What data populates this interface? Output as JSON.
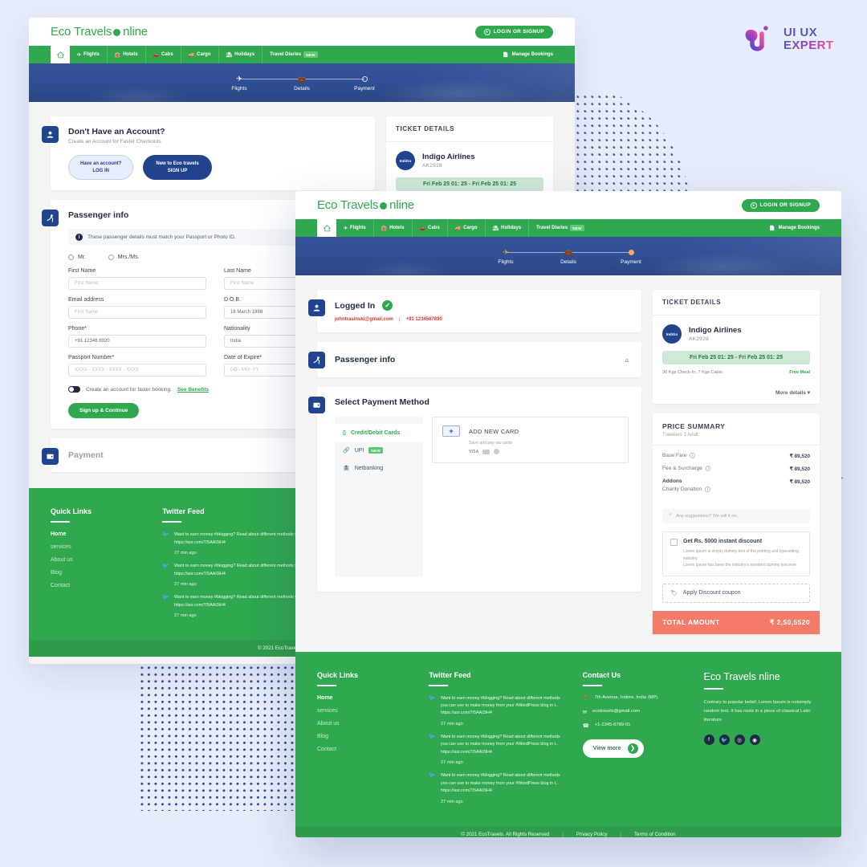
{
  "brand_logo": {
    "line1": "UI UX",
    "line2": "EXPERT"
  },
  "colors": {
    "green": "#2fa84f",
    "navy": "#22448f",
    "hero": "#2b4a93",
    "accent_orange": "#f09b2e",
    "total_bar": "#f47b6a",
    "red_text": "#e0342c"
  },
  "header": {
    "logo_prefix": "Eco Travels ",
    "logo_suffix": "nline",
    "login_button": "LOGIN OR SIGNUP",
    "login_icon": "user-icon"
  },
  "nav": {
    "home_icon": "home-icon",
    "items": [
      {
        "label": "Flights",
        "icon": "plane-icon",
        "badge": ""
      },
      {
        "label": "Hotels",
        "icon": "hotel-icon",
        "badge": ""
      },
      {
        "label": "Cabs",
        "icon": "cab-icon",
        "badge": ""
      },
      {
        "label": "Cargo",
        "icon": "cargo-icon",
        "badge": ""
      },
      {
        "label": "Holidays",
        "icon": "holiday-icon",
        "badge": ""
      },
      {
        "label": "Travel Diaries",
        "icon": "",
        "badge": "NEW"
      }
    ],
    "manage_bookings": "Manage Bookings",
    "manage_icon": "ticket-icon"
  },
  "stepper": {
    "steps": [
      {
        "label": "Flights",
        "icon": "plane-icon",
        "state": "done"
      },
      {
        "label": "Details",
        "icon": "suitcase-icon",
        "state": "active"
      },
      {
        "label": "Payment",
        "icon": "circle-icon",
        "state": "pending"
      }
    ]
  },
  "account_panel": {
    "icon": "user-icon",
    "title": "Don't Have an Account?",
    "subtitle": "Create an Account for Faster Checkouts",
    "login_btn_top": "Have an account?",
    "login_btn_bottom": "LOG IN",
    "signup_btn_top": "New to Eco travels",
    "signup_btn_bottom": "SIGN UP"
  },
  "logged_in_panel": {
    "icon": "user-icon",
    "title": "Logged In",
    "check_icon": "check-circle-icon",
    "email": "johntrasinski@gmail.com",
    "separator": "|",
    "phone": "+91 1234567890"
  },
  "passenger_panel": {
    "icon": "passenger-icon",
    "title": "Passenger info",
    "collapse_icon": "chevron-up-icon",
    "notice": "These passenger details must match your Passport or Photo ID.",
    "notice_icon": "info-icon",
    "titles": [
      "Mr.",
      "Mrs./Ms."
    ],
    "fields": [
      {
        "label": "First Name",
        "value": "First Name",
        "filled": false
      },
      {
        "label": "Last Name",
        "value": "First Name",
        "filled": false
      },
      {
        "label": "Email address",
        "value": "First Name",
        "filled": false
      },
      {
        "label": "D.O.B.",
        "value": "16 March 1998",
        "filled": true
      },
      {
        "label": "Phone*",
        "value": "+91 12346 8920",
        "filled": true
      },
      {
        "label": "Nationality",
        "value": "India",
        "filled": true
      },
      {
        "label": "Passport Number*",
        "value": "XXXX - XXXX - XXXX - XXXX",
        "filled": false
      },
      {
        "label": "Date of Expire*",
        "value": "DD - MM -YY",
        "filled": false
      }
    ],
    "toggle_text": "Create an account for faster booking.",
    "toggle_link": "See Benefits",
    "submit_button": "Sign up & Continue"
  },
  "payment_panel": {
    "icon": "wallet-icon",
    "title": "Payment",
    "select_title": "Select Payment Method",
    "methods": [
      {
        "label": "Credit/Debit Cards",
        "icon": "card-icon",
        "badge": "",
        "active": true
      },
      {
        "label": "UPI",
        "icon": "link-icon",
        "badge": "NEW",
        "active": false
      },
      {
        "label": "Netbanking",
        "icon": "bank-icon",
        "badge": "",
        "active": false
      }
    ],
    "add_card": {
      "plus_icon": "plus-icon",
      "title": "ADD NEW CARD",
      "subtitle": "Save and pay via cards",
      "visa_label": "VISA"
    }
  },
  "ticket_details": {
    "heading": "TICKET DETAILS",
    "airline_logo_text": "IndiGo",
    "airline": "Indigo Airlines",
    "flight_code": "AK2928",
    "time_range": "Fri Feb 25 01: 25 - Fri Feb 25 01: 25",
    "baggage": "30 Kgs Check-In, 7 Kgs Cabin",
    "meal": "Free Meal",
    "more_details": "More details",
    "more_icon": "chevron-down-icon"
  },
  "price_summary": {
    "heading": "PRICE SUMMARY",
    "travelers": "Travelers 1 Adult",
    "rows": [
      {
        "label": "Base Fare",
        "sublabel": "",
        "info": true,
        "value": "₹ 89,520"
      },
      {
        "label": "Fee & Surcharge",
        "sublabel": "",
        "info": true,
        "value": "₹ 89,520"
      },
      {
        "label": "Addons",
        "sublabel": "Charity Donation",
        "info": true,
        "value": "₹ 89,520"
      }
    ],
    "suggestion_placeholder": "Any suggestions? We will it on..",
    "discount": {
      "title": "Get Rs. 5000 instant discount",
      "line1": "Lorem Ipsum is simply dummy text of the printing and typesetting industry.",
      "line2": "Lorem Ipsum has been the industry's standard dummy text ever"
    },
    "coupon_label": "Apply Discount coupon",
    "coupon_icon": "tag-icon",
    "total_label": "TOTAL AMOUNT",
    "total_value": "₹ 2,50,5520"
  },
  "footer": {
    "quick_links": {
      "title": "Quick Links",
      "items": [
        "Home",
        "services",
        "About us",
        "Blog",
        "Contact"
      ]
    },
    "twitter": {
      "title": "Twitter Feed",
      "icon": "twitter-icon",
      "tweets": [
        {
          "text": "Want to earn money #blogging? Read about different methods you can use to make money from your #WordPress blog in t.. https://asr.com/7/5AAI3iH4",
          "time": "27 min ago"
        },
        {
          "text": "Want to earn money #blogging? Read about different methods you can use to make money from your #WordPress blog in t.. https://asr.com/7/5AAI3iH4",
          "time": "27 min ago"
        },
        {
          "text": "Want to earn money #blogging? Read about different methods you can use to make money from your #WordPress blog in t.. https://asr.com/7/5AAI3iH4",
          "time": "27 min ago"
        }
      ]
    },
    "contact": {
      "title": "Contact Us",
      "address": "7th Avenue, Indore, India (MP).",
      "address_icon": "location-icon",
      "email": "ecotravels@gmail.com",
      "email_icon": "mail-icon",
      "phone": "+1-2345-6789-01",
      "phone_icon": "phone-icon",
      "view_more": "View more",
      "view_more_icon": "arrow-right-icon"
    },
    "about": {
      "logo_prefix": "Eco Travels ",
      "logo_suffix": "nline",
      "description": "Contrary to popular belief, Lorem Ipsum is notsimply random text. It has roots in a piece of classical Latin literature",
      "socials": [
        "facebook-icon",
        "twitter-icon",
        "instagram-icon",
        "pinterest-icon"
      ]
    },
    "bottom": {
      "copyright": "© 2021 EcoTravels. All Rights Reserved",
      "privacy": "Privacy Policy",
      "terms": "Terms of Condition",
      "divider": "|"
    }
  }
}
